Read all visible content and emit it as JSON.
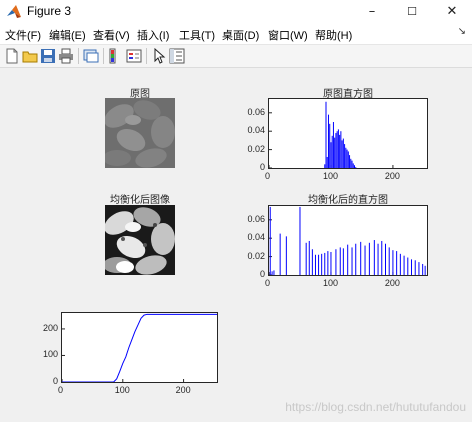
{
  "window": {
    "title": "Figure 3",
    "app_icon": "matlab-icon"
  },
  "window_controls": {
    "minimize": "–",
    "maximize": "☐",
    "close": "✕"
  },
  "menu": [
    {
      "label": "文件(F)"
    },
    {
      "label": "编辑(E)"
    },
    {
      "label": "查看(V)"
    },
    {
      "label": "插入(I)"
    },
    {
      "label": "工具(T)"
    },
    {
      "label": "桌面(D)"
    },
    {
      "label": "窗口(W)"
    },
    {
      "label": "帮助(H)"
    }
  ],
  "toolbar_icons": [
    "new-figure-icon",
    "open-file-icon",
    "save-icon",
    "print-icon",
    "link-plot-icon",
    "insert-colorbar-icon",
    "insert-legend-icon",
    "edit-plot-arrow-icon",
    "property-inspector-icon"
  ],
  "dock_arrow": "↘",
  "colors": {
    "line": "#0000ff",
    "axis": "#262626"
  },
  "plots": {
    "orig_image_title": "原图",
    "orig_hist_title": "原图直方图",
    "eq_image_title": "均衡化后图像",
    "eq_hist_title": "均衡化后的直方图"
  },
  "chart_data": [
    {
      "type": "bar",
      "title": "原图直方图",
      "xlim": [
        0,
        255
      ],
      "ylim": [
        0,
        0.075
      ],
      "xticks": [
        0,
        100,
        200
      ],
      "yticks": [
        0,
        0.02,
        0.04,
        0.06
      ],
      "ytick_labels": [
        "0",
        "0.02",
        "0.04",
        "0.06"
      ],
      "x": [
        90,
        92,
        94,
        96,
        98,
        100,
        102,
        104,
        106,
        108,
        110,
        112,
        114,
        116,
        118,
        120,
        122,
        124,
        126,
        128,
        130,
        132,
        134,
        136,
        138,
        140
      ],
      "values": [
        0.004,
        0.072,
        0.012,
        0.058,
        0.048,
        0.028,
        0.035,
        0.05,
        0.033,
        0.038,
        0.04,
        0.042,
        0.036,
        0.04,
        0.03,
        0.032,
        0.026,
        0.022,
        0.02,
        0.018,
        0.014,
        0.01,
        0.008,
        0.005,
        0.003,
        0.001
      ]
    },
    {
      "type": "bar",
      "title": "均衡化后的直方图",
      "xlim": [
        0,
        255
      ],
      "ylim": [
        0,
        0.075
      ],
      "xticks": [
        0,
        100,
        200
      ],
      "yticks": [
        0,
        0.02,
        0.04,
        0.06
      ],
      "ytick_labels": [
        "0",
        "0.02",
        "0.04",
        "0.06"
      ],
      "x": [
        2,
        5,
        8,
        18,
        28,
        50,
        60,
        65,
        70,
        75,
        80,
        85,
        90,
        95,
        100,
        108,
        115,
        120,
        127,
        134,
        140,
        148,
        155,
        162,
        170,
        176,
        182,
        188,
        194,
        200,
        206,
        212,
        218,
        224,
        230,
        236,
        242,
        248,
        252
      ],
      "values": [
        0.074,
        0.004,
        0.005,
        0.045,
        0.042,
        0.074,
        0.035,
        0.037,
        0.028,
        0.022,
        0.022,
        0.023,
        0.024,
        0.026,
        0.025,
        0.028,
        0.03,
        0.029,
        0.033,
        0.03,
        0.034,
        0.036,
        0.032,
        0.035,
        0.038,
        0.034,
        0.037,
        0.034,
        0.03,
        0.027,
        0.026,
        0.023,
        0.021,
        0.019,
        0.017,
        0.016,
        0.014,
        0.012,
        0.01
      ]
    },
    {
      "type": "line",
      "title": "",
      "xlim": [
        0,
        255
      ],
      "ylim": [
        0,
        260
      ],
      "xticks": [
        0,
        100,
        200
      ],
      "yticks": [
        0,
        100,
        200
      ],
      "ytick_labels": [
        "0",
        "100",
        "200"
      ],
      "x": [
        0,
        85,
        90,
        95,
        100,
        105,
        110,
        115,
        120,
        125,
        130,
        135,
        140,
        255
      ],
      "y": [
        0,
        0,
        12,
        40,
        70,
        95,
        130,
        160,
        190,
        215,
        240,
        252,
        255,
        255
      ]
    }
  ],
  "watermark": "https://blog.csdn.net/hututufandou"
}
